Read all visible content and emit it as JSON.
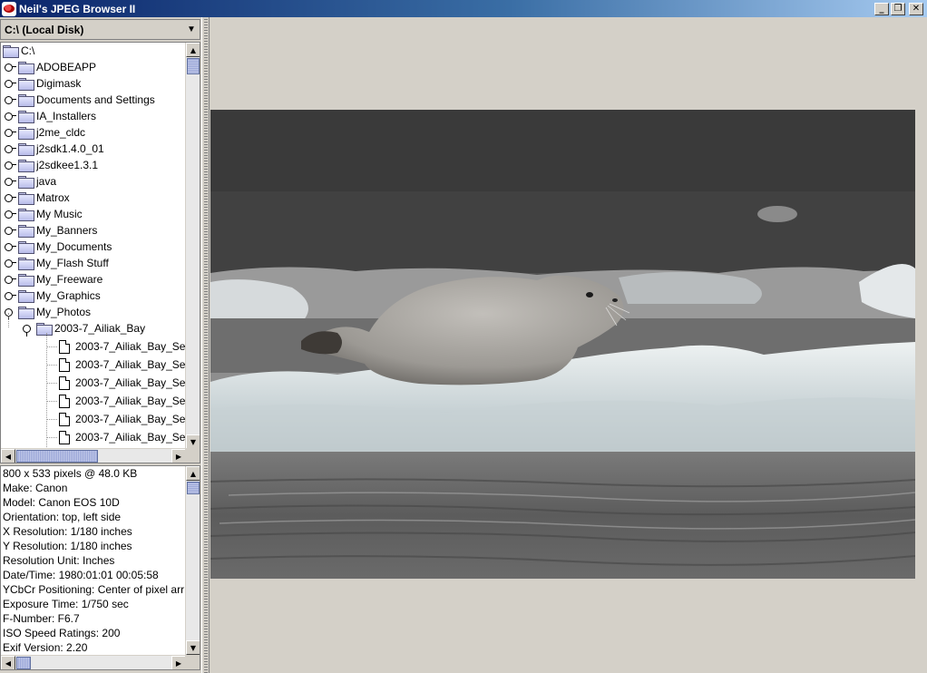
{
  "window": {
    "title": "Neil's JPEG Browser II",
    "minimize_glyph": "_",
    "maximize_glyph": "❐",
    "close_glyph": "✕"
  },
  "drive_selector": {
    "selected": "C:\\ (Local Disk)",
    "arrow_glyph": "▼"
  },
  "tree": {
    "root": "C:\\",
    "folders": [
      "ADOBEAPP",
      "Digimask",
      "Documents and Settings",
      "IA_Installers",
      "j2me_cldc",
      "j2sdk1.4.0_01",
      "j2sdkee1.3.1",
      "java",
      "Matrox",
      "My Music",
      "My_Banners",
      "My_Documents",
      "My_Flash Stuff",
      "My_Freeware",
      "My_Graphics",
      "My_Photos"
    ],
    "expanded_subfolder": "2003-7_Ailiak_Bay",
    "files": [
      "2003-7_Ailiak_Bay_Se",
      "2003-7_Ailiak_Bay_Se",
      "2003-7_Ailiak_Bay_Se",
      "2003-7_Ailiak_Bay_Se",
      "2003-7_Ailiak_Bay_Se",
      "2003-7_Ailiak_Bay_Se"
    ]
  },
  "scrollbar_glyphs": {
    "up": "▲",
    "down": "▼",
    "left": "◀",
    "right": "▶"
  },
  "exif_info": [
    "800 x 533 pixels @ 48.0 KB",
    "Make: Canon",
    "Model: Canon EOS 10D",
    "Orientation: top, left side",
    "X Resolution: 1/180 inches",
    "Y Resolution: 1/180 inches",
    "Resolution Unit: Inches",
    "Date/Time: 1980:01:01 00:05:58",
    "YCbCr Positioning: Center of pixel arr",
    "Exposure Time: 1/750 sec",
    "F-Number: F6.7",
    "ISO Speed Ratings: 200",
    "Exif Version: 2.20"
  ],
  "colors": {
    "titlebar_start": "#0a246a",
    "titlebar_end": "#a6caf0",
    "panel_bg": "#d4d0c8",
    "scroll_thumb": "#9aa6d8"
  }
}
